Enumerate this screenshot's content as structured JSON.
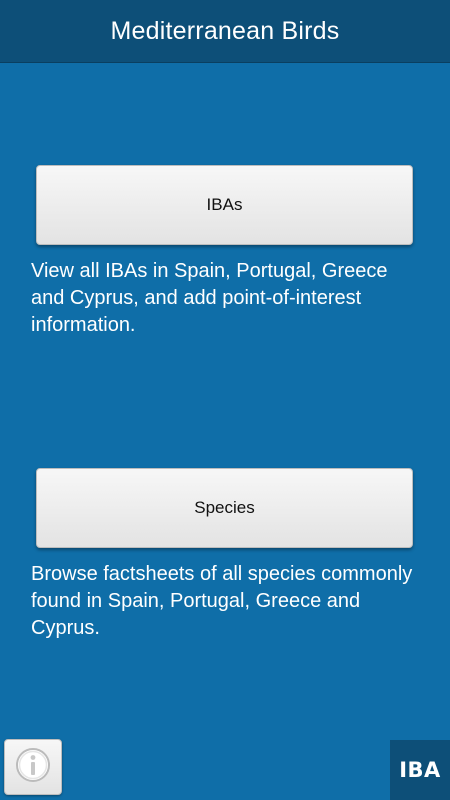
{
  "header": {
    "title": "Mediterranean Birds"
  },
  "sections": [
    {
      "button_label": "IBAs",
      "description": "View all IBAs in Spain, Portugal, Greece and Cyprus, and add point-of-interest information."
    },
    {
      "button_label": "Species",
      "description": "Browse factsheets of all species commonly found in Spain, Portugal, Greece and Cyprus."
    }
  ],
  "footer": {
    "info_icon": "info-icon",
    "logo_text": "IBA"
  },
  "colors": {
    "background": "#0f6ea8",
    "app_bar": "#0d4f78",
    "button": "#f0f0f0",
    "text": "#ffffff"
  }
}
